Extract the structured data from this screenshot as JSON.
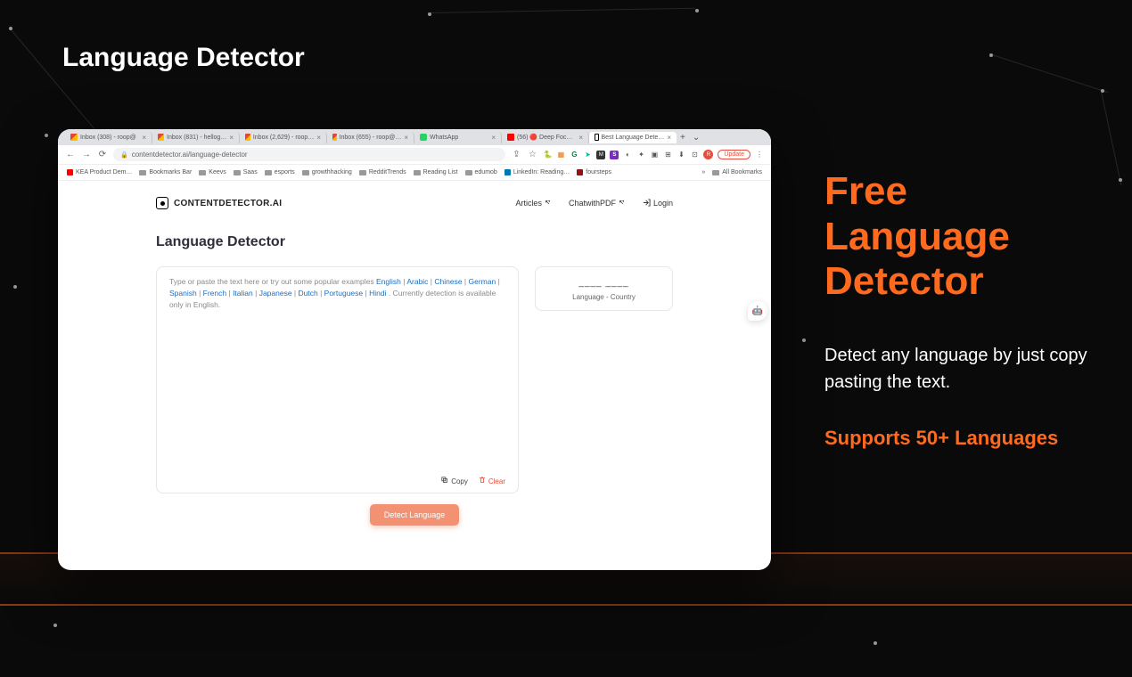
{
  "page_title": "Language Detector",
  "browser": {
    "tabs": [
      {
        "label": "Inbox (308) - roop@",
        "favicon": "gmail"
      },
      {
        "label": "Inbox (831) - hellog…",
        "favicon": "gmail"
      },
      {
        "label": "Inbox (2,629) - roop…",
        "favicon": "gmail"
      },
      {
        "label": "Inbox (655) - roop@…",
        "favicon": "gmail"
      },
      {
        "label": "WhatsApp",
        "favicon": "wa"
      },
      {
        "label": "(56) 🔴 Deep Foc…",
        "favicon": "yt"
      },
      {
        "label": "Best Language Dete…",
        "favicon": "cd",
        "active": true
      }
    ],
    "url": "contentdetector.ai/language-detector",
    "update_button": "Update",
    "bookmarks": [
      "KEA Product Dem…",
      "Bookmarks Bar",
      "Keevs",
      "Saas",
      "esports",
      "growthhacking",
      "RedditTrends",
      "Reading List",
      "edumob",
      "LinkedIn: Reading…",
      "foursteps"
    ],
    "all_bookmarks": "All Bookmarks"
  },
  "app": {
    "logo_text": "CONTENTDETECTOR.AI",
    "nav": {
      "articles": "Articles",
      "chatpdf": "ChatwithPDF",
      "login": "Login"
    },
    "section_title": "Language Detector",
    "placeholder_prefix": "Type or paste the text here or try out some popular examples ",
    "languages": [
      "English",
      "Arabic",
      "Chinese",
      "German",
      "Spanish",
      "French",
      "Italian",
      "Japanese",
      "Dutch",
      "Portuguese",
      "Hindi"
    ],
    "placeholder_suffix": " . Currently detection is available only in English.",
    "copy": "Copy",
    "clear": "Clear",
    "result_placeholder": "____  ____",
    "result_label": "Language - Country",
    "detect_button": "Detect Language",
    "chat_emoji": "🤖"
  },
  "promo": {
    "title": "Free Language Detector",
    "desc": "Detect any language by just copy pasting the text.",
    "sub": "Supports 50+ Languages"
  }
}
